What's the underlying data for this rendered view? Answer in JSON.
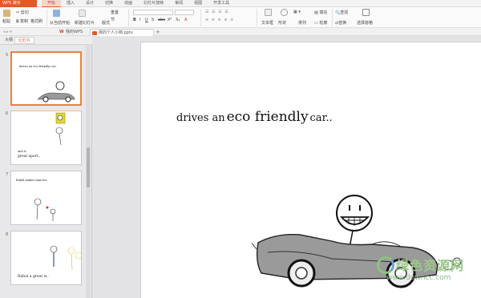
{
  "app": {
    "name": "WPS 演示"
  },
  "menu": [
    "开始",
    "插入",
    "设计",
    "切换",
    "动画",
    "幻灯片放映",
    "审阅",
    "视图",
    "开发工具"
  ],
  "ribbon": {
    "clipboard": {
      "paste": "粘贴",
      "cut": "剪切",
      "copy": "复制",
      "format_painter": "格式刷"
    },
    "slides": {
      "from_current": "从当前开始",
      "new_slide": "新建幻灯片",
      "layout": "版式",
      "reset": "重置",
      "section": "节"
    },
    "font": {
      "bold": "B",
      "italic": "I",
      "underline": "U",
      "shadow": "S",
      "strike": "abc",
      "superscript": "X²",
      "subscript": "X₂",
      "font_color": "A"
    },
    "insert": {
      "textbox": "文本框",
      "shape": "形状",
      "arrange": "排列",
      "outline": "轮廓",
      "fill": "填充"
    },
    "editing": {
      "find": "查找",
      "replace": "替换",
      "select": "选择窗格"
    }
  },
  "doc_tabs": [
    {
      "label": "我的WPS",
      "active": false
    },
    {
      "label": "我的个人小档.pptx",
      "active": true
    }
  ],
  "panel": {
    "tabs": [
      "大纲",
      "幻灯片"
    ],
    "active_tab": "幻灯片"
  },
  "thumbnails": [
    {
      "num": "5",
      "text": "drives an eco friendly car.."
    },
    {
      "num": "6",
      "text": "and is",
      "text2": "great sport.."
    },
    {
      "num": "7",
      "text": "Rahul makes time for.."
    },
    {
      "num": "8",
      "text": "Rahul a great w.."
    }
  ],
  "slide": {
    "text_small": "drives an",
    "text_big": "eco friendly",
    "text_end": "car.."
  },
  "watermark": {
    "cn": "绿色资源网",
    "url": "www.downcc.com"
  },
  "colors": {
    "accent": "#e25a2a",
    "selected_border": "#e8813d",
    "watermark": "#8fc37d"
  }
}
